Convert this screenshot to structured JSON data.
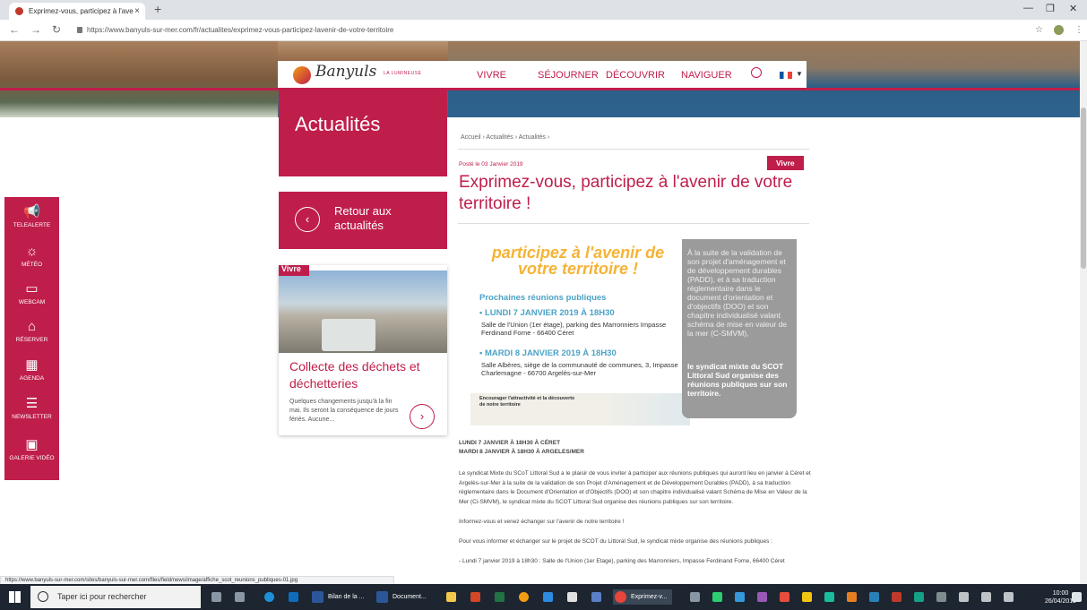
{
  "browser": {
    "tab_title": "Exprimez-vous, participez à l'ave",
    "url": "https://www.banyuls-sur-mer.com/fr/actualites/exprimez-vous-participez-lavenir-de-votre-territoire",
    "status_url": "https://www.banyuls-sur-mer.com/sites/banyuls-sur-mer.com/files/field/news/image/affiche_scot_reunions_publiques-01.jpg"
  },
  "header": {
    "logo_text": "Banyuls",
    "logo_sub": "LA LUMINEUSE",
    "menu": [
      "VIVRE",
      "SÉJOURNER",
      "DÉCOUVRIR",
      "NAVIGUER"
    ]
  },
  "sidebar": {
    "items": [
      {
        "label": "TELEALERTE",
        "icon": "megaphone-icon",
        "glyph": "📢"
      },
      {
        "label": "MÉTÉO",
        "icon": "sun-icon",
        "glyph": "☼"
      },
      {
        "label": "WEBCAM",
        "icon": "camera-icon",
        "glyph": "▭"
      },
      {
        "label": "RÉSERVER",
        "icon": "bell-icon",
        "glyph": "⌂"
      },
      {
        "label": "AGENDA",
        "icon": "calendar-icon",
        "glyph": "▦"
      },
      {
        "label": "NEWSLETTER",
        "icon": "newsletter-icon",
        "glyph": "☰"
      },
      {
        "label": "GALERIE VIDÉO",
        "icon": "image-icon",
        "glyph": "▣"
      }
    ]
  },
  "page": {
    "title": "Actualités",
    "back_label": "Retour aux actualités",
    "breadcrumb": "Accueil › Actualités › Actualités ›",
    "posted": "Posté le 03 Janvier 2019",
    "category": "Vivre",
    "article_title": "Exprimez-vous, participez à l'avenir de votre territoire !"
  },
  "card": {
    "tag": "Vivre",
    "title": "Collecte des déchets et déchetteries",
    "excerpt": "Quelques changements jusqu'à la fin mai. Ils seront la conséquence de jours fériés. Aucune..."
  },
  "poster": {
    "headline": "participez à l'avenir de votre territoire !",
    "subtitle": "Prochaines réunions publiques",
    "date1": "• LUNDI 7 JANVIER 2019 À 18H30",
    "addr1": "Salle de l'Union (1er étage), parking des Marronniers Impasse Ferdinand Forne - 66400 Céret",
    "date2": "• MARDI 8 JANVIER 2019 À 18H30",
    "addr2": "Salle Albères, siège de la communauté de communes, 3, Impasse Charlemagne - 66700 Argelès-sur-Mer",
    "map_label": "Encourager l'attractivité et la découverte de notre territoire",
    "side_text": "À la suite de la validation de son projet d'aménagement et de développement durables (PADD), et à sa traduction réglementaire dans le document d'orientation et d'objectifs (DOO) et son chapitre individualisé valant schéma de mise en valeur de la mer (C-SMVM),",
    "side_bold": "le syndicat mixte du SCOT Littoral Sud organise des réunions publiques sur son territoire."
  },
  "article": {
    "heading1": "LUNDI 7 JANVIER À 18H30 À CÉRET",
    "heading2": "MARDI 8 JANVIER À 18H30 À ARGELES/MER",
    "p1": "Le syndicat Mixte du SCoT Littoral Sud a le plaisir de vous inviter à participer aux réunions publiques qui auront lieu en janvier à Céret et Argelès-sur-Mer à la suite de la validation de son Projet d'Aménagement et de Développement Durables (PADD), à sa traduction réglementaire dans le Document d'Orientation et d'Objectifs (DOO) et son chapitre individualisé valant Schéma de Mise en Valeur de la Mer (Ci-SMVM), le syndicat mixte du SCOT Littoral Sud organise des réunions publiques sur son territoire.",
    "p1b": "Informez-vous et venez échanger sur l'avenir de notre territoire !",
    "p2": "Pour vous informer et échanger sur le projet de SCOT du Littoral Sud, le syndicat mixte organise des réunions publiques :",
    "p3": "- Lundi 7 janvier 2019 à 18h30 : Salle de l'Union (1er Etage), parking des Marronniers, Impasse Ferdinand Forne, 66400 Céret"
  },
  "taskbar": {
    "search_placeholder": "Taper ici pour rechercher",
    "apps": [
      "Bilan de la ...",
      "Document...",
      "Exprimez-v..."
    ],
    "time": "10:00",
    "date": "26/04/2019"
  },
  "colors": {
    "accent": "#bf1e4b",
    "poster_orange": "#f5b335",
    "poster_blue": "#4aa3c7"
  }
}
